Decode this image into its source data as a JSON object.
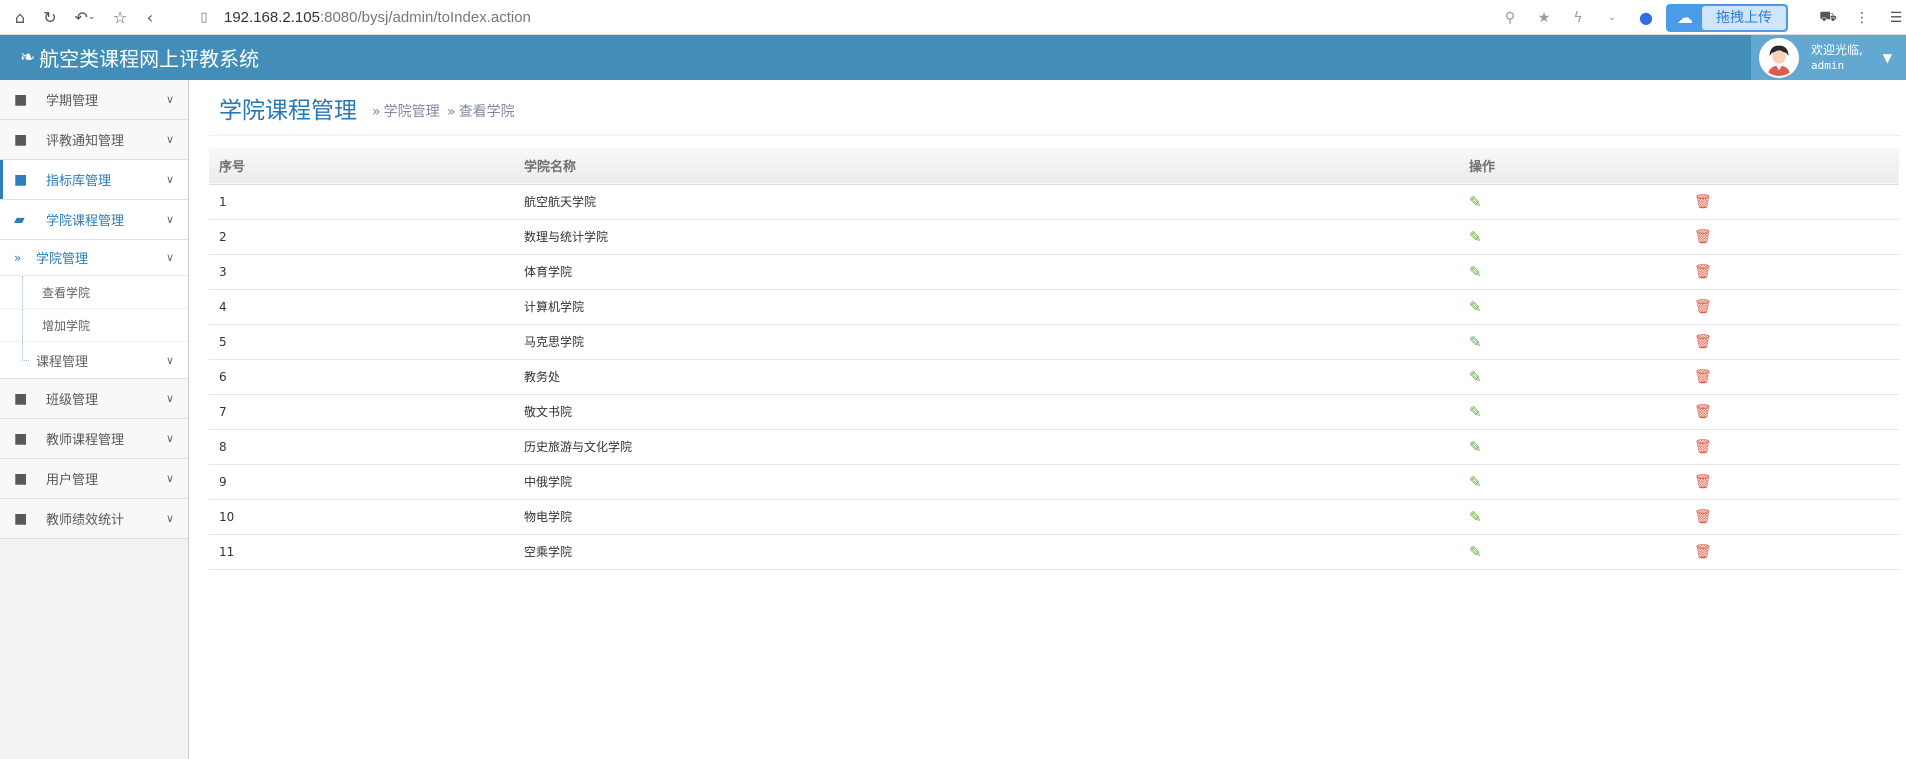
{
  "browser": {
    "url_host": "192.168.2.105",
    "url_rest": ":8080/bysj/admin/toIndex.action",
    "upload_label": "拖拽上传"
  },
  "header": {
    "title": "航空类课程网上评教系统",
    "welcome": "欢迎光临,",
    "username": "admin"
  },
  "sidebar": {
    "items": [
      {
        "label": "学期管理"
      },
      {
        "label": "评教通知管理"
      },
      {
        "label": "指标库管理"
      },
      {
        "label": "学院课程管理"
      }
    ],
    "submenu": {
      "current_label": "学院管理",
      "children": [
        {
          "label": "查看学院"
        },
        {
          "label": "增加学院"
        }
      ],
      "course_label": "课程管理"
    },
    "items_after": [
      {
        "label": "班级管理"
      },
      {
        "label": "教师课程管理"
      },
      {
        "label": "用户管理"
      },
      {
        "label": "教师绩效统计"
      }
    ]
  },
  "page": {
    "title": "学院课程管理",
    "breadcrumb": [
      "学院管理",
      "查看学院"
    ]
  },
  "table": {
    "headers": [
      "序号",
      "学院名称",
      "操作"
    ],
    "rows": [
      {
        "id": "1",
        "name": "航空航天学院"
      },
      {
        "id": "2",
        "name": "数理与统计学院"
      },
      {
        "id": "3",
        "name": "体育学院"
      },
      {
        "id": "4",
        "name": "计算机学院"
      },
      {
        "id": "5",
        "name": "马克思学院"
      },
      {
        "id": "6",
        "name": "教务处"
      },
      {
        "id": "7",
        "name": "敬文书院"
      },
      {
        "id": "8",
        "name": "历史旅游与文化学院"
      },
      {
        "id": "9",
        "name": "中俄学院"
      },
      {
        "id": "10",
        "name": "物电学院"
      },
      {
        "id": "11",
        "name": "空乘学院"
      }
    ]
  },
  "colors": {
    "header_bg": "#438eb9",
    "accent": "#2b7dbc",
    "edit": "#69aa46",
    "delete": "#dd5a43"
  }
}
